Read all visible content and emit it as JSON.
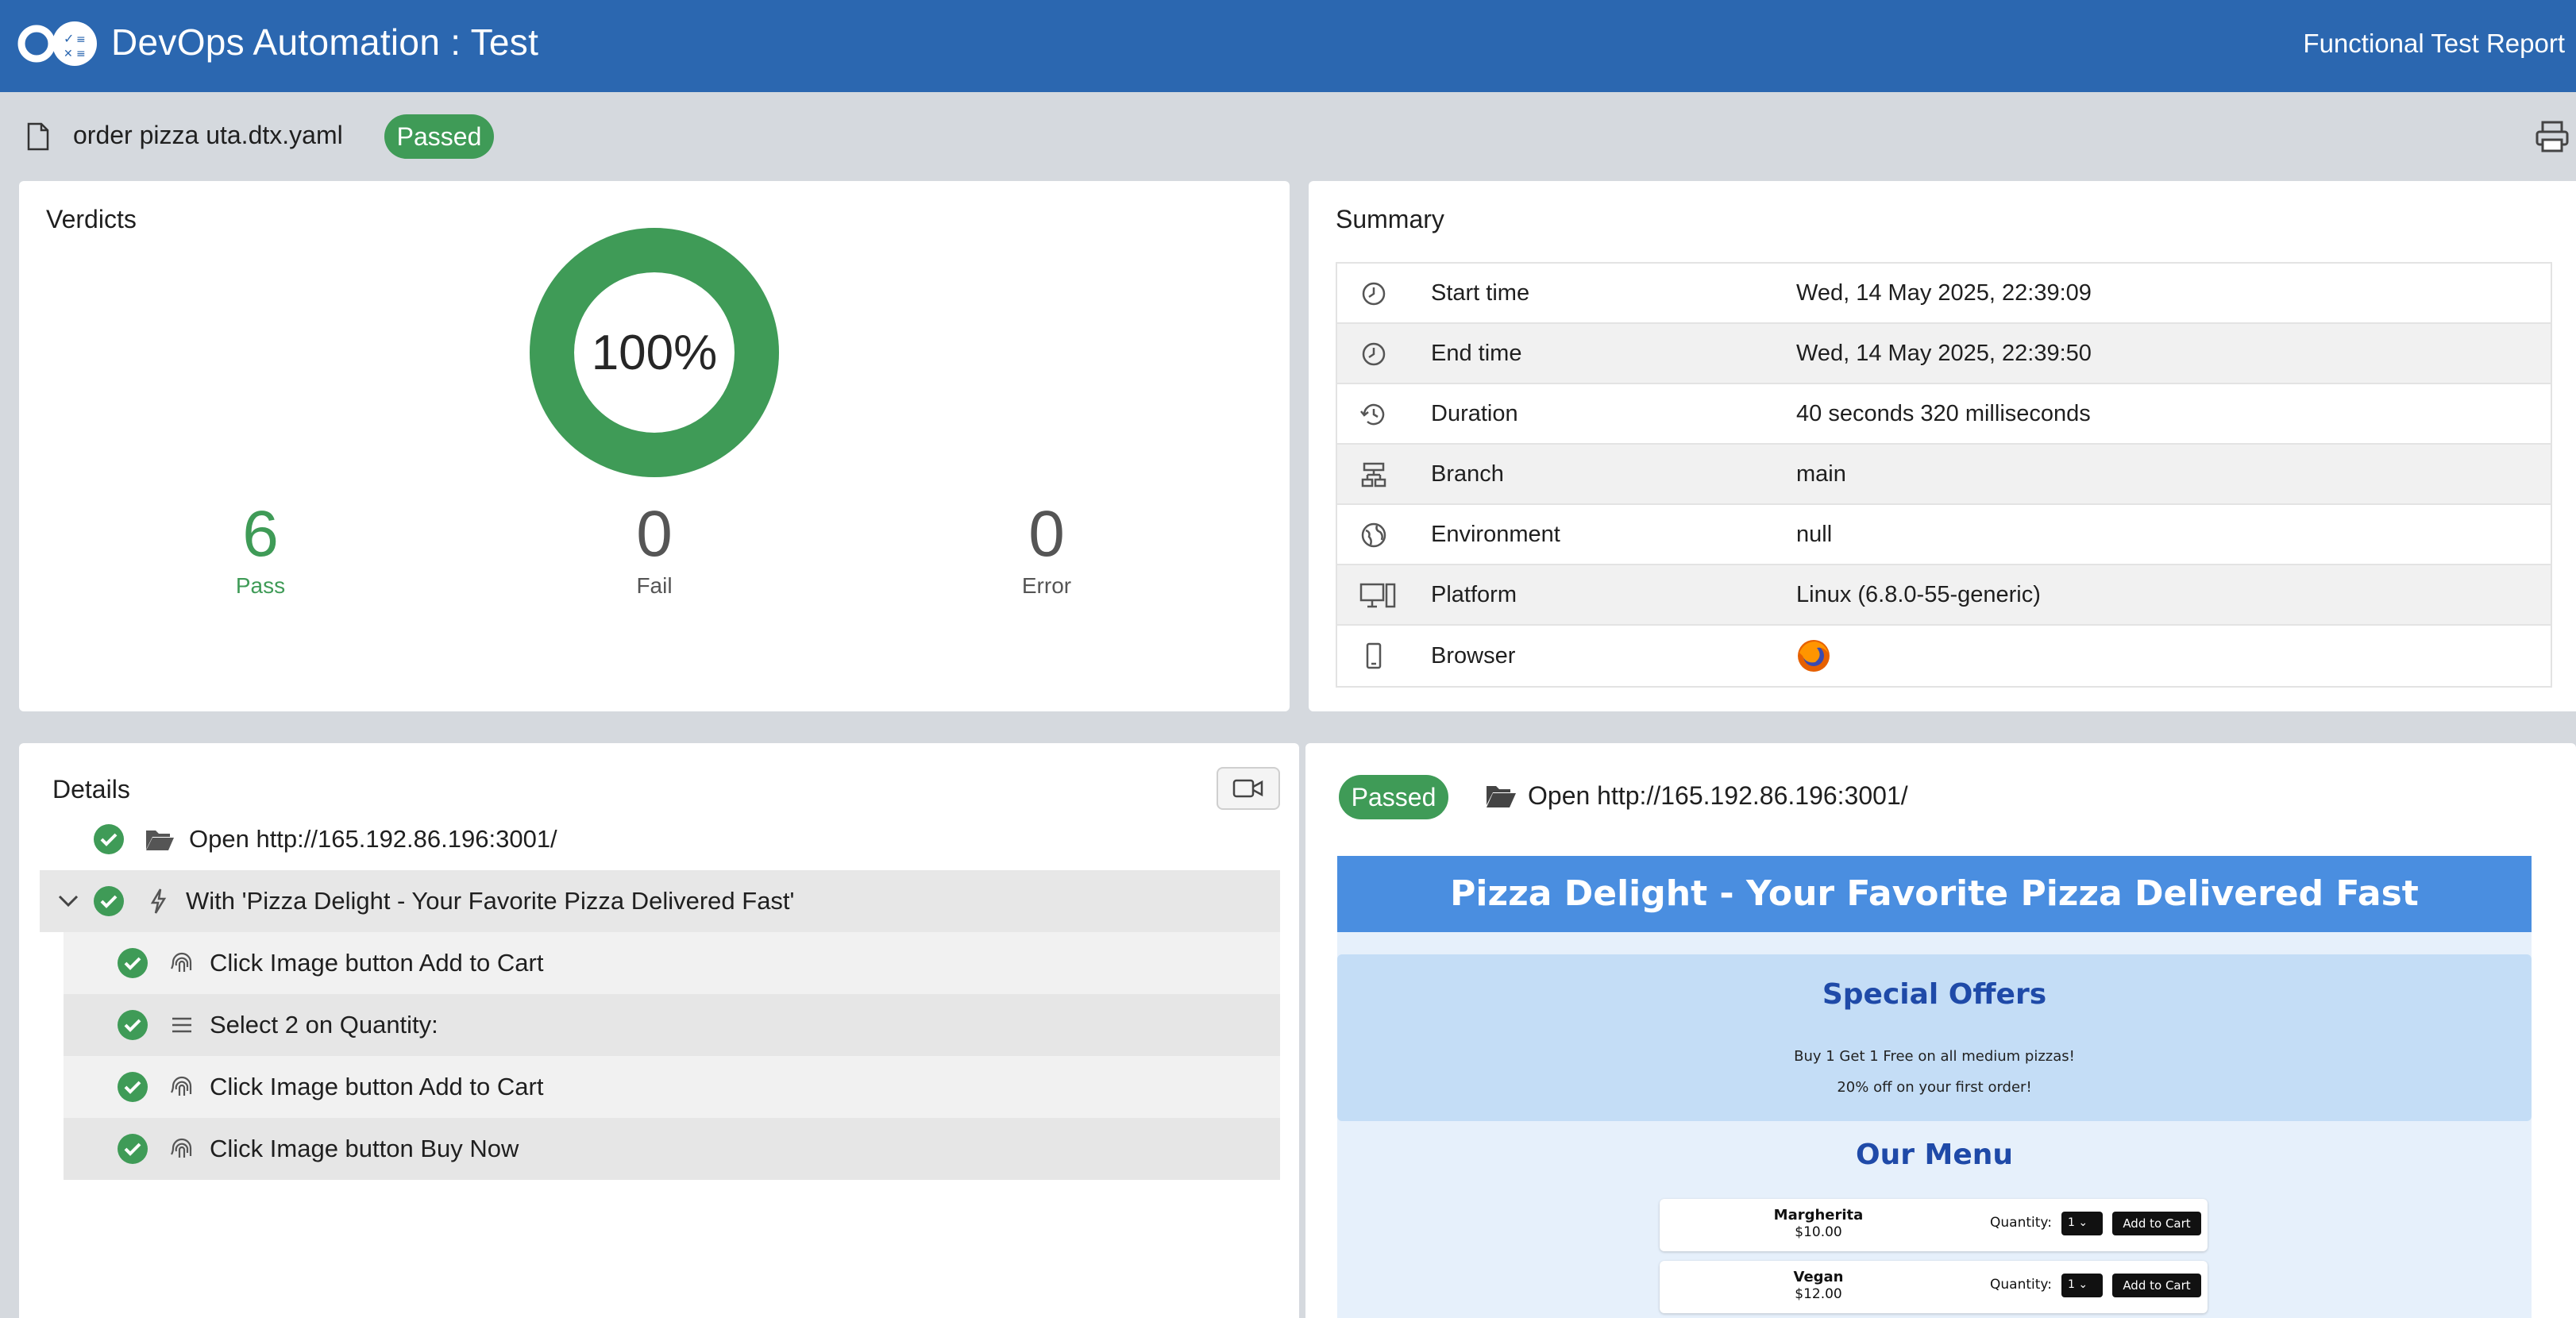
{
  "header": {
    "title": "DevOps Automation : Test",
    "report_link": "Functional Test Report",
    "brand_color": "#2b67b0"
  },
  "file": {
    "name": "order pizza uta.dtx.yaml",
    "status": "Passed"
  },
  "verdicts": {
    "title": "Verdicts",
    "percent_label": "100%",
    "pass_fraction": 1.0,
    "pass": {
      "count": "6",
      "label": "Pass"
    },
    "fail": {
      "count": "0",
      "label": "Fail"
    },
    "error": {
      "count": "0",
      "label": "Error"
    },
    "pass_color": "#3f9b57"
  },
  "summary": {
    "title": "Summary",
    "rows": [
      {
        "icon": "clock-icon",
        "label": "Start time",
        "value": "Wed, 14 May 2025, 22:39:09"
      },
      {
        "icon": "clock-icon",
        "label": "End time",
        "value": "Wed, 14 May 2025, 22:39:50"
      },
      {
        "icon": "history-icon",
        "label": "Duration",
        "value": "40 seconds 320 milliseconds"
      },
      {
        "icon": "branch-icon",
        "label": "Branch",
        "value": "main"
      },
      {
        "icon": "globe-icon",
        "label": "Environment",
        "value": "null"
      },
      {
        "icon": "monitor-icon",
        "label": "Platform",
        "value": "Linux (6.8.0-55-generic)"
      },
      {
        "icon": "mobile-icon",
        "label": "Browser",
        "value": "firefox-icon"
      }
    ]
  },
  "details": {
    "title": "Details",
    "steps": [
      {
        "level": 0,
        "icon": "folder-open-icon",
        "text": "Open http://165.192.86.196:3001/"
      },
      {
        "level": 1,
        "icon": "bolt-icon",
        "text": "With 'Pizza Delight - Your Favorite Pizza Delivered Fast'"
      },
      {
        "level": 2,
        "icon": "fingerprint-icon",
        "text": "Click Image button Add to Cart"
      },
      {
        "level": 2,
        "icon": "list-icon",
        "text": "Select 2 on Quantity:"
      },
      {
        "level": 2,
        "icon": "fingerprint-icon",
        "text": "Click Image button Add to Cart"
      },
      {
        "level": 2,
        "icon": "fingerprint-icon",
        "text": "Click Image button Buy Now"
      }
    ]
  },
  "preview": {
    "status": "Passed",
    "title": "Open http://165.192.86.196:3001/",
    "page": {
      "heading": "Pizza Delight - Your Favorite Pizza Delivered Fast",
      "offers_title": "Special Offers",
      "offers": [
        "Buy 1 Get 1 Free on all medium pizzas!",
        "20% off on your first order!"
      ],
      "menu_title": "Our Menu",
      "items": [
        {
          "name": "Margherita",
          "price": "$10.00",
          "qty_label": "Quantity:",
          "qty": "1",
          "button": "Add to Cart"
        },
        {
          "name": "Vegan",
          "price": "$12.00",
          "qty_label": "Quantity:",
          "qty": "1",
          "button": "Add to Cart"
        }
      ]
    }
  }
}
